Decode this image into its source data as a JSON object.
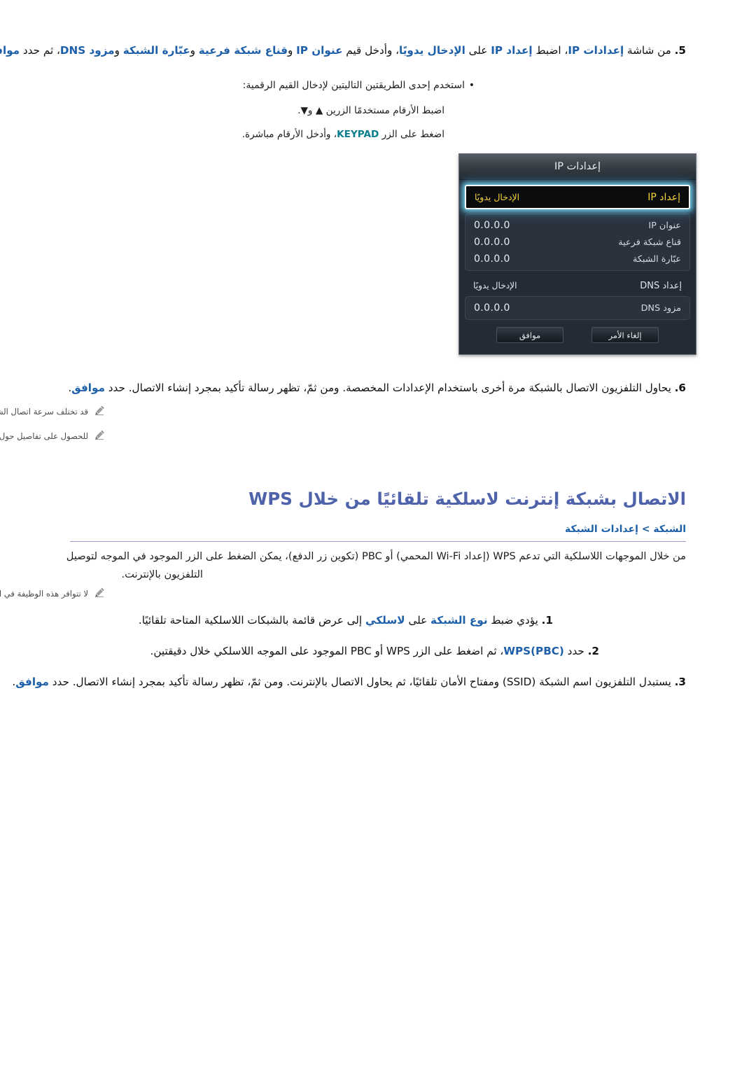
{
  "steps_ip": {
    "step5": {
      "num": "5.",
      "seg1": "من شاشة ",
      "b1": "إعدادات IP",
      "seg2": "، اضبط ",
      "b2": "إعداد IP",
      "seg3": " على ",
      "b3": "الإدخال يدويًا",
      "seg4": "، وأدخل قيم ",
      "b4": "عنوان IP",
      "seg5": " و",
      "b5": "قناع شبكة فرعية",
      "seg6": " و",
      "b6": "عبّارة الشبكة",
      "seg7": " و",
      "b7": "مزود DNS",
      "seg8": "، ثم حدد ",
      "b8": "موافق",
      "seg9": "."
    },
    "bullet_intro": "استخدم إحدى الطريقتين التاليتين لإدخال القيم الرقمية:",
    "sub1": "اضبط الأرقام مستخدمًا الزرين ▲ و▼.",
    "sub2_a": "اضغط على الزر ",
    "sub2_key": "KEYPAD",
    "sub2_b": "، وأدخل الأرقام مباشرة."
  },
  "osd": {
    "title": "إعدادات IP",
    "focused_row": {
      "label": "إعداد IP",
      "value": "الإدخال يدويًا"
    },
    "value_rows": [
      {
        "label": "عنوان IP",
        "value": "0.0.0.0"
      },
      {
        "label": "قناع شبكة فرعية",
        "value": "0.0.0.0"
      },
      {
        "label": "عبّارة الشبكة",
        "value": "0.0.0.0"
      }
    ],
    "dns_setup": {
      "label": "إعداد DNS",
      "value": "الإدخال يدويًا"
    },
    "dns_server": {
      "label": "مزود DNS",
      "value": "0.0.0.0"
    },
    "buttons": {
      "cancel": "إلغاء الأمر",
      "ok": "موافق"
    }
  },
  "steps_ip2": {
    "step6": {
      "num": "6.",
      "seg1": "يحاول التلفزيون الاتصال بالشبكة مرة أخرى باستخدام الإعدادات المخصصة. ومن ثمّ، تظهر رسالة تأكيد بمجرد إنشاء الاتصال. حدد ",
      "b1": "موافق",
      "seg2": "."
    },
    "note1": "قد تختلف سرعة اتصال الشبكة باختلاف إعدادات خادم DNS.",
    "note2": "للحصول على تفاصيل حول إعدادات خادم DNS، اتصل بموفر خدمة الإنترنت (ISP)."
  },
  "wps_section": {
    "title": "الاتصال بشبكة إنترنت لاسلكية تلقائيًا من خلال WPS",
    "breadcrumb": "الشبكة > إعدادات الشبكة",
    "intro_line1": "من خلال الموجهات اللاسلكية التي تدعم WPS (إعداد Wi-Fi المحمي) أو PBC (تكوين زر الدفع)، يمكن الضغط على الزر الموجود في الموجه لتوصيل",
    "intro_line2": "التلفزيون بالإنترنت.",
    "note1": "لا تتوافر هذه الوظيفة في الموجهات اللاسلكية التي لا تدعم WPS. تحقق مما إذا كان الموجه اللاسلكي الخاص بك يدعم WPS.",
    "step1": {
      "num": "1.",
      "seg1": "يؤدي ضبط ",
      "b1": "نوع الشبكة",
      "seg2": " على ",
      "b2": "لاسلكي",
      "seg3": " إلى عرض قائمة بالشبكات اللاسلكية المتاحة تلقائيًا."
    },
    "step2": {
      "num": "2.",
      "seg1": "حدد ",
      "b1": "WPS(PBC)",
      "seg2": "، ثم اضغط على الزر WPS أو PBC الموجود على الموجه اللاسلكي خلال دقيقتين."
    },
    "step3": {
      "num": "3.",
      "seg1": "يستبدل التلفزيون اسم الشبكة (SSID) ومفتاح الأمان تلقائيًا، ثم يحاول الاتصال بالإنترنت. ومن ثمّ، تظهر رسالة تأكيد بمجرد إنشاء الاتصال. حدد ",
      "b1": "موافق",
      "seg2": "."
    }
  },
  "colors": {
    "accent_blue": "#1d5fa8",
    "heading_purple": "#4f63ab",
    "teal": "#0a7d8c",
    "osd_highlight_text": "#f3d23a",
    "osd_bg": "#242b35"
  }
}
